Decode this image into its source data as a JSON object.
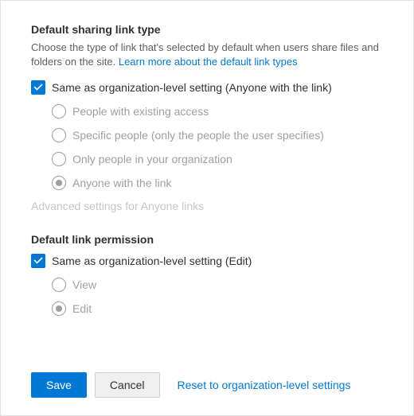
{
  "link_type": {
    "title": "Default sharing link type",
    "description_prefix": "Choose the type of link that's selected by default when users share files and folders on the site. ",
    "learn_more": "Learn more about the default link types",
    "same_as_org": {
      "label": "Same as organization-level setting (Anyone with the link)",
      "checked": true
    },
    "options": [
      {
        "label": "People with existing access",
        "selected": false
      },
      {
        "label": "Specific people (only the people the user specifies)",
        "selected": false
      },
      {
        "label": "Only people in your organization",
        "selected": false
      },
      {
        "label": "Anyone with the link",
        "selected": true
      }
    ],
    "advanced": "Advanced settings for Anyone links"
  },
  "link_permission": {
    "title": "Default link permission",
    "same_as_org": {
      "label": "Same as organization-level setting (Edit)",
      "checked": true
    },
    "options": [
      {
        "label": "View",
        "selected": false
      },
      {
        "label": "Edit",
        "selected": true
      }
    ]
  },
  "footer": {
    "save": "Save",
    "cancel": "Cancel",
    "reset": "Reset to organization-level settings"
  }
}
